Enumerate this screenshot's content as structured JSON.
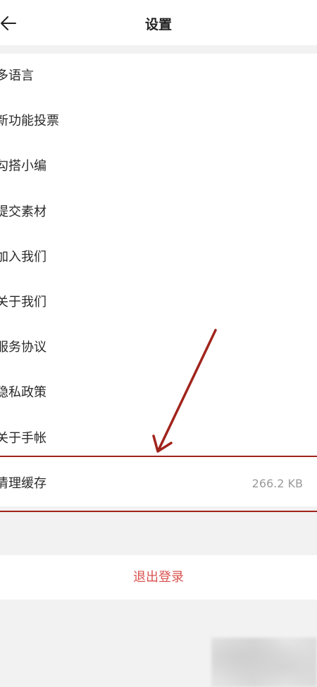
{
  "header": {
    "title": "设置",
    "back_icon": "arrow-left-icon"
  },
  "settings": {
    "items": [
      {
        "label": "多语言",
        "value": ""
      },
      {
        "label": "新功能投票",
        "value": ""
      },
      {
        "label": "勾搭小编",
        "value": ""
      },
      {
        "label": "提交素材",
        "value": ""
      },
      {
        "label": "加入我们",
        "value": ""
      },
      {
        "label": "关于我们",
        "value": ""
      },
      {
        "label": "服务协议",
        "value": ""
      },
      {
        "label": "隐私政策",
        "value": ""
      },
      {
        "label": "关于手帐",
        "value": ""
      },
      {
        "label": "清理缓存",
        "value": "266.2 KB"
      }
    ]
  },
  "logout": {
    "label": "退出登录"
  },
  "colors": {
    "accent_red": "#d9534f",
    "annotation_red": "#a0241c",
    "background": "#f2f2f2"
  }
}
